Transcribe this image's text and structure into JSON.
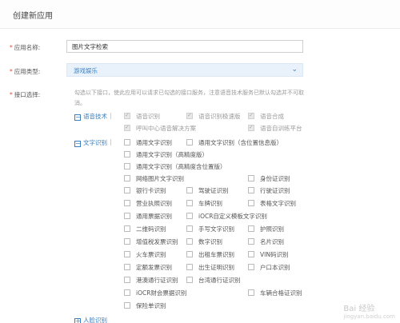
{
  "header": {
    "title": "创建新应用"
  },
  "form": {
    "app_name": {
      "label": "应用名称:",
      "value": "图片文字检索"
    },
    "app_type": {
      "label": "应用类型:",
      "value": "游戏娱乐"
    },
    "api": {
      "label": "接口选择:",
      "hint": "勾选以下接口，使此应用可以请求已勾选的接口服务，注意语音技术服务已默认勾选并不可取消。"
    }
  },
  "categories": {
    "speech": "语音技术",
    "ocr": "文字识别",
    "face": "人脸识别"
  },
  "speech_options": [
    "语音识别",
    "语音识别极速版",
    "语音合成",
    "呼叫中心语音解决方案",
    "语音自训练平台"
  ],
  "ocr_options": [
    "通用文字识别",
    "通用文字识别（含位置信息版）",
    "通用文字识别（高精度版）",
    "通用文字识别（高精度含位置版）",
    "网络图片文字识别",
    "身份证识别",
    "银行卡识别",
    "驾驶证识别",
    "行驶证识别",
    "营业执照识别",
    "车牌识别",
    "表格文字识别",
    "通用票据识别",
    "iOCR自定义模板文字识别",
    "二维码识别",
    "手写文字识别",
    "护照识别",
    "增值税发票识别",
    "数字识别",
    "名片识别",
    "火车票识别",
    "出租车票识别",
    "VIN码识别",
    "定额发票识别",
    "出生证明识别",
    "户口本识别",
    "港澳通行证识别",
    "台湾通行证识别",
    "iOCR财会票据识别",
    "车辆合格证识别",
    "保险单识别"
  ],
  "watermark": {
    "brand": "Bai 经验",
    "url": "jingyan.baidu.com"
  },
  "colors": {
    "accent": "#3a7fc2",
    "required": "#e24a3b",
    "select_bg": "#e9f2fb"
  }
}
